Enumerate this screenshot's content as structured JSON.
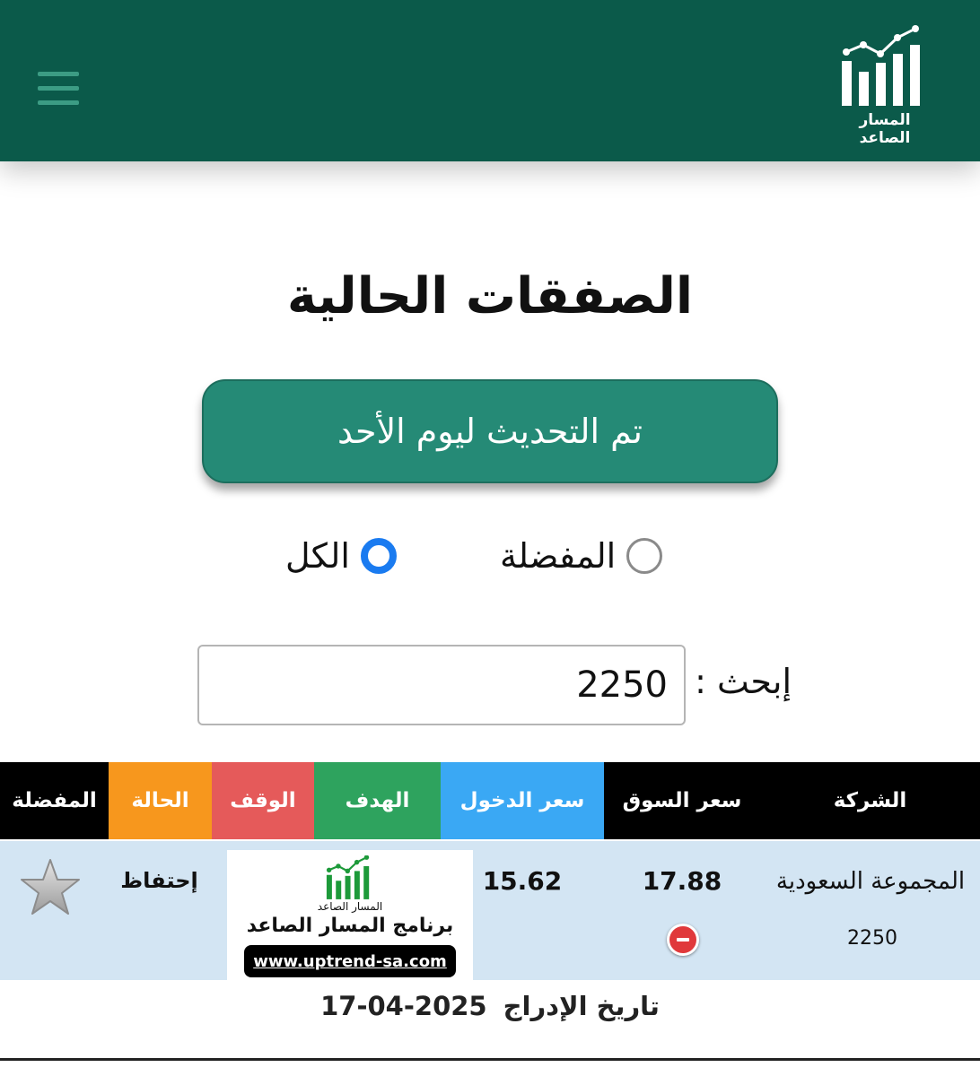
{
  "header": {
    "logo_text": "المسار الصاعد",
    "menu_icon": "hamburger-menu-icon",
    "logo_icon": "rising-bar-chart-logo-icon",
    "background_color": "#0b5a4a"
  },
  "page_title": "الصفقات الحالية",
  "update_button": {
    "label": "تم التحديث ليوم الأحد",
    "color": "#258a76"
  },
  "filters": {
    "favorites_label": "المفضلة",
    "favorites_selected": false,
    "all_label": "الكل",
    "all_selected": true
  },
  "search": {
    "label": "إبحث :",
    "value": "2250"
  },
  "table": {
    "headers": [
      {
        "key": "company",
        "label": "الشركة",
        "color": "#000000"
      },
      {
        "key": "market_price",
        "label": "سعر السوق",
        "color": "#000000"
      },
      {
        "key": "entry_price",
        "label": "سعر الدخول",
        "color": "#3aa8f4"
      },
      {
        "key": "target",
        "label": "الهدف",
        "color": "#2ea35e"
      },
      {
        "key": "stop",
        "label": "الوقف",
        "color": "#e55a5a"
      },
      {
        "key": "status",
        "label": "الحالة",
        "color": "#f7971d"
      },
      {
        "key": "favorite",
        "label": "المفضلة",
        "color": "#000000"
      }
    ],
    "rows": [
      {
        "company_name": "المجموعة السعودية",
        "company_code": "2250",
        "market_price": "17.88",
        "entry_price": "15.62",
        "status": "إحتفاظ",
        "favorite": false
      }
    ],
    "row_background": "#d3e5f3"
  },
  "ad_overlay": {
    "small_text": "المسار الصاعد",
    "title": "برنامج المسار الصاعد",
    "url": "www.uptrend-sa.com"
  },
  "listing": {
    "label": "تاريخ الإدراج",
    "date": "2025-04-17"
  }
}
